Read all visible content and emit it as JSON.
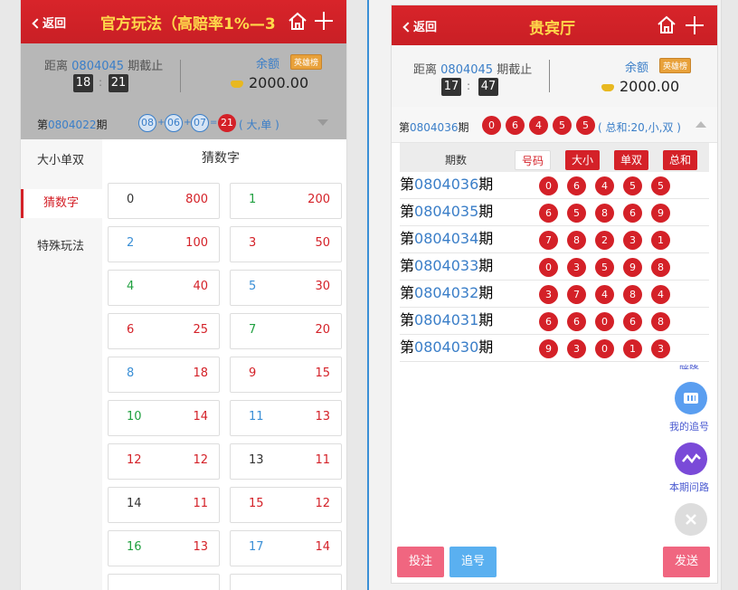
{
  "left": {
    "header": {
      "back": "返回",
      "title": "官方玩法（高赔率1%—3"
    },
    "info": {
      "countdown_prefix": "距离",
      "issue": "0804045",
      "countdown_suffix": "期截止",
      "minutes": "18",
      "seconds": "21",
      "balance_label": "余额",
      "hero_badge": "英雄榜",
      "balance": "2000.00"
    },
    "last": {
      "prefix": "第",
      "issue": "0804022",
      "suffix": "期",
      "balls": [
        "08",
        "06",
        "07"
      ],
      "ops": [
        "+",
        "+",
        "="
      ],
      "result": "21",
      "result_text": "( 大,单 )"
    },
    "sidebar": [
      "大小单双",
      "猜数字",
      "特殊玩法"
    ],
    "grid_title": "猜数字",
    "cells": [
      {
        "num": "0",
        "odds": "800",
        "color": "#333333"
      },
      {
        "num": "1",
        "odds": "200",
        "color": "#20a040"
      },
      {
        "num": "2",
        "odds": "100",
        "color": "#3a8fd6"
      },
      {
        "num": "3",
        "odds": "50",
        "color": "#d42128"
      },
      {
        "num": "4",
        "odds": "40",
        "color": "#20a040"
      },
      {
        "num": "5",
        "odds": "30",
        "color": "#3a8fd6"
      },
      {
        "num": "6",
        "odds": "25",
        "color": "#d42128"
      },
      {
        "num": "7",
        "odds": "20",
        "color": "#20a040"
      },
      {
        "num": "8",
        "odds": "18",
        "color": "#3a8fd6"
      },
      {
        "num": "9",
        "odds": "15",
        "color": "#d42128"
      },
      {
        "num": "10",
        "odds": "14",
        "color": "#20a040"
      },
      {
        "num": "11",
        "odds": "13",
        "color": "#3a8fd6"
      },
      {
        "num": "12",
        "odds": "12",
        "color": "#d42128"
      },
      {
        "num": "13",
        "odds": "11",
        "color": "#333333"
      },
      {
        "num": "14",
        "odds": "11",
        "color": "#333333"
      },
      {
        "num": "15",
        "odds": "12",
        "color": "#d42128"
      },
      {
        "num": "16",
        "odds": "13",
        "color": "#20a040"
      },
      {
        "num": "17",
        "odds": "14",
        "color": "#3a8fd6"
      }
    ]
  },
  "right": {
    "header": {
      "back": "返回",
      "title": "贵宾厅"
    },
    "info": {
      "countdown_prefix": "距离",
      "issue": "0804045",
      "countdown_suffix": "期截止",
      "minutes": "17",
      "seconds": "47",
      "balance_label": "余额",
      "hero_badge": "英雄榜",
      "balance": "2000.00"
    },
    "last": {
      "prefix": "第",
      "issue": "0804036",
      "suffix": "期",
      "balls": [
        "0",
        "6",
        "4",
        "5",
        "5"
      ],
      "summary": "( 总和:20,小,双 )"
    },
    "table": {
      "headers": [
        "期数",
        "号码",
        "大小",
        "单双",
        "总和"
      ],
      "rows": [
        {
          "issue": "0804036",
          "balls": [
            "0",
            "6",
            "4",
            "5",
            "5"
          ]
        },
        {
          "issue": "0804035",
          "balls": [
            "6",
            "5",
            "8",
            "6",
            "9"
          ]
        },
        {
          "issue": "0804034",
          "balls": [
            "7",
            "8",
            "2",
            "3",
            "1"
          ]
        },
        {
          "issue": "0804033",
          "balls": [
            "0",
            "3",
            "5",
            "9",
            "8"
          ]
        },
        {
          "issue": "0804032",
          "balls": [
            "3",
            "7",
            "4",
            "8",
            "4"
          ]
        },
        {
          "issue": "0804031",
          "balls": [
            "6",
            "6",
            "0",
            "6",
            "8"
          ]
        },
        {
          "issue": "0804030",
          "balls": [
            "9",
            "3",
            "0",
            "1",
            "3"
          ]
        }
      ]
    },
    "floating": {
      "partial": "咪降",
      "my_tracking": "我的追号",
      "current_q": "本期问路"
    },
    "buttons": {
      "bet": "投注",
      "track": "追号",
      "send": "发送"
    }
  },
  "colors": {
    "red": "#d42128",
    "blue": "#3a7ec8",
    "green": "#20a040",
    "pink": "#f06680",
    "sky": "#5ab0f0"
  }
}
